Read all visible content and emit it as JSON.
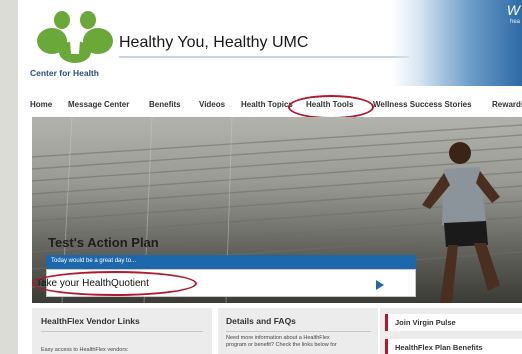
{
  "header": {
    "logo_text": "Center for Health",
    "site_title": "Healthy You, Healthy UMC",
    "right_banner_text": "W",
    "right_banner_subtext": "hea"
  },
  "nav": {
    "items": [
      "Home",
      "Message Center",
      "Benefits",
      "Videos",
      "Health Topics",
      "Health Tools",
      "Wellness Success Stories",
      "Rewards"
    ],
    "highlighted": "Health Tools"
  },
  "hero": {
    "title": "Test's Action Plan",
    "subtitle": "Today would be a great day to...",
    "action_link": "Take your HealthQuotient"
  },
  "panels": {
    "vendor": {
      "title": "HealthFlex Vendor Links",
      "text": "Easy access to HealthFlex vendors:"
    },
    "details": {
      "title": "Details and FAQs",
      "text_line1": "Need more information about a HealthFlex",
      "text_line2": "program or benefit? Check the links below for"
    },
    "side_links": [
      "Join Virgin Pulse",
      "HealthFlex Plan Benefits"
    ]
  },
  "colors": {
    "accent_blue": "#1d68aa",
    "highlight_red": "#b0182e",
    "logo_green": "#6aa83a"
  }
}
